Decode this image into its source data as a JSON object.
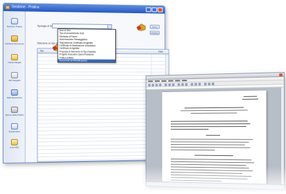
{
  "back_window": {
    "title": "Gestione - Pratica",
    "sidebar": [
      {
        "label": "Gestione Pratica",
        "icon": "folder-icon"
      },
      {
        "label": "Gestione Documenti",
        "icon": "document-icon"
      },
      {
        "label": "Carica Allegati",
        "icon": "pencil-icon"
      },
      {
        "label": "Altri Soggetti",
        "icon": "users-icon"
      },
      {
        "label": "Stati Documento",
        "icon": "status-icon"
      },
      {
        "label": "Storico della Pratica",
        "icon": "history-icon"
      },
      {
        "label": "Scadenzario",
        "icon": "calendar-icon"
      },
      {
        "label": "Invio PEC",
        "icon": "mail-icon"
      }
    ],
    "tipologia_label": "Tipologia di Doc.",
    "seleziona_label": "Seleziona un tipo di pratica",
    "dropdown_items": [
      "Mod di Vibo",
      "Tipo di procedimento SUE",
      "Richiesta di Parere",
      "Autorizzazione Paesaggistica",
      "Segnalazione Certificata di Agibilità",
      "Certificato di Destinazione Urbanistica",
      "Certificato di Agibilità",
      "Proposta di Intervento di Tipo Pubblico",
      "Progetto Esecutivo Opere Pubbliche",
      "Pratica Edilizia",
      "Documenti SIT/Pianificazione"
    ],
    "selected_index": 10,
    "grid_header_left": "Tipo",
    "grid_header_right": "Data",
    "buttons": [
      "Nuovo",
      "Modifica"
    ]
  },
  "front_window": {
    "document": "Word processor document page"
  }
}
